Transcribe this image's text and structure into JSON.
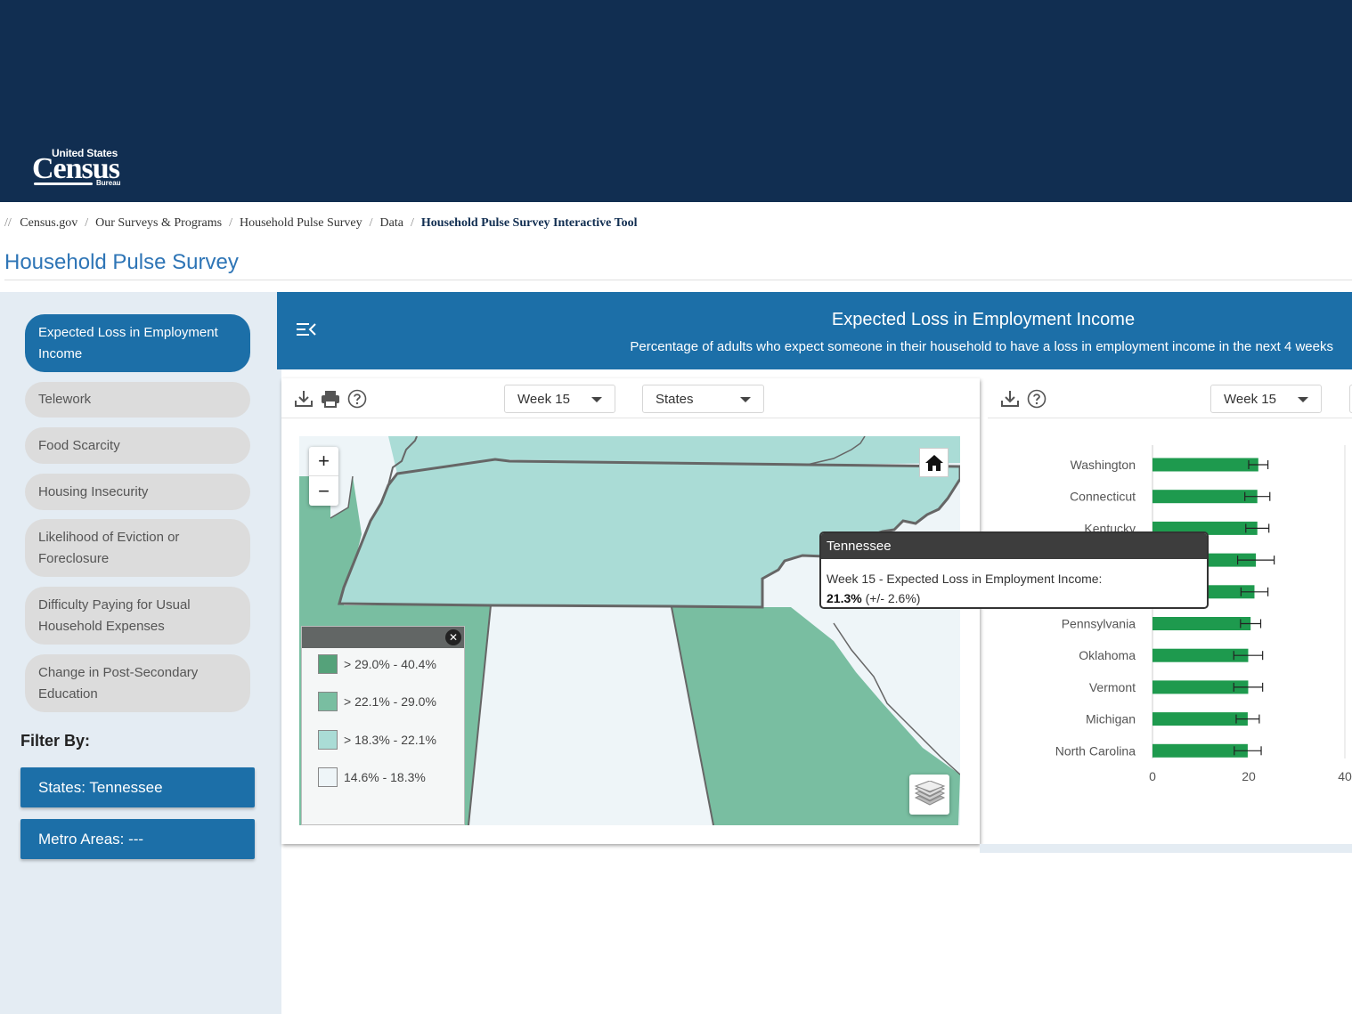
{
  "logo": {
    "line1": "United States",
    "line2": "Census",
    "line3": "Bureau"
  },
  "breadcrumb": {
    "lead": "//",
    "items": [
      "Census.gov",
      "Our Surveys & Programs",
      "Household Pulse Survey",
      "Data"
    ],
    "current": "Household Pulse Survey Interactive Tool",
    "separator": "/"
  },
  "page_title": "Household Pulse Survey",
  "sidebar": {
    "topics": [
      "Expected Loss in Employment Income",
      "Telework",
      "Food Scarcity",
      "Housing Insecurity",
      "Likelihood of Eviction or Foreclosure",
      "Difficulty Paying for Usual Household Expenses",
      "Change in Post-Secondary Education"
    ],
    "active_topic": "Expected Loss in Employment Income",
    "filter_title": "Filter By:",
    "filter_states": "States: Tennessee",
    "filter_metro": "Metro Areas: ---"
  },
  "banner": {
    "title": "Expected Loss in Employment Income",
    "subtitle": "Percentage of adults who expect someone in their household to have a loss in employment income in the next 4 weeks"
  },
  "map_panel": {
    "week_select": "Week 15",
    "geo_select": "States",
    "zoom_in": "+",
    "zoom_out": "−",
    "legend": [
      {
        "label": "> 29.0% - 40.4%",
        "color": "#55a27a"
      },
      {
        "label": "> 22.1% - 29.0%",
        "color": "#79bea1"
      },
      {
        "label": "> 18.3% - 22.1%",
        "color": "#aadcd6"
      },
      {
        "label": "14.6% - 18.3%",
        "color": "#eef5f8"
      }
    ],
    "legend_close": "✕"
  },
  "tooltip": {
    "title": "Tennessee",
    "line1": "Week 15 - Expected Loss in Employment Income:",
    "value": "21.3%",
    "moe": "(+/- 2.6%)"
  },
  "bar_panel": {
    "week_select": "Week 15",
    "chart_data": {
      "type": "bar",
      "orientation": "horizontal",
      "categories": [
        "Washington",
        "Connecticut",
        "Kentucky",
        "",
        "",
        "Pennsylvania",
        "Oklahoma",
        "Vermont",
        "Michigan",
        "North Carolina"
      ],
      "values": [
        22,
        21.8,
        21.8,
        21.5,
        21.2,
        20.4,
        19.9,
        19.9,
        19.8,
        19.8
      ],
      "errors": [
        2.0,
        2.6,
        2.4,
        3.8,
        2.8,
        2.1,
        3.0,
        3.0,
        2.4,
        2.8
      ],
      "xlim": [
        0,
        40
      ],
      "xticks": [
        "0",
        "20",
        "40"
      ],
      "bar_color": "#1e9a4e"
    }
  },
  "colors": {
    "header": "#112e51",
    "accent": "#1c6fa8",
    "sidebar": "#e4ecf3"
  }
}
